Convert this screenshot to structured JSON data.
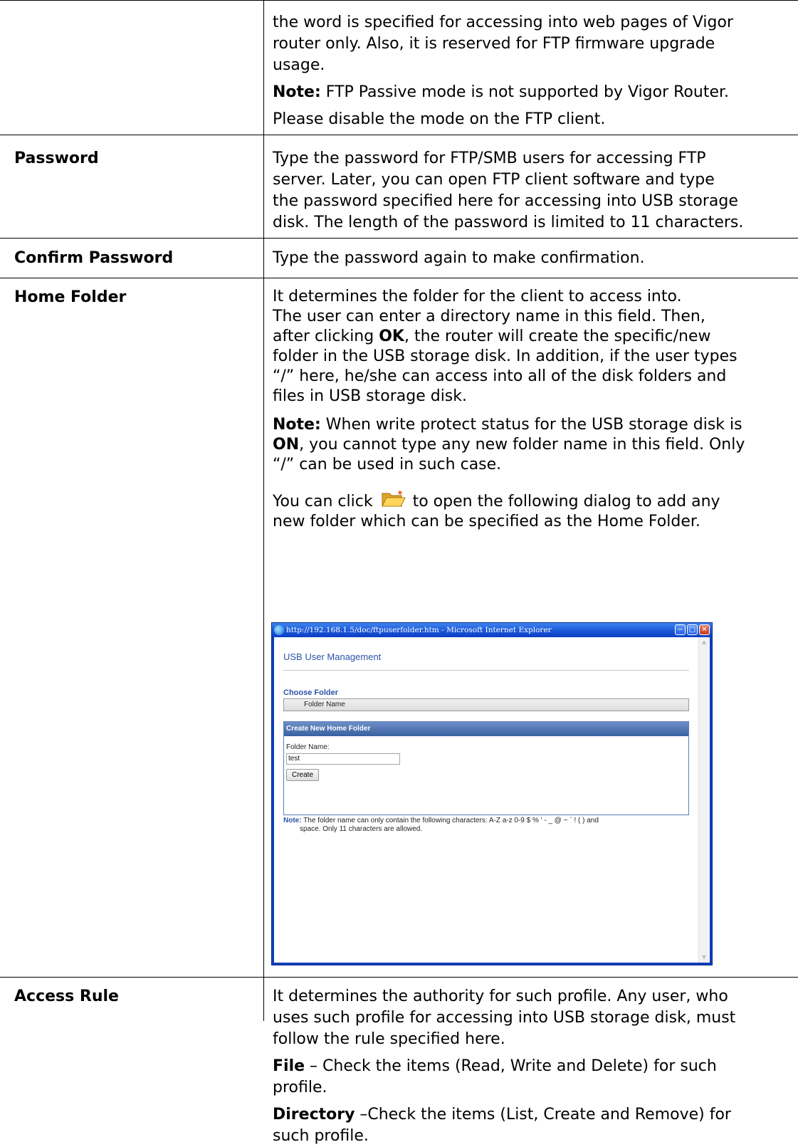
{
  "rows": {
    "first": {
      "lines": [
        "the word is specified for accessing into web pages of Vigor",
        "router only. Also, it is reserved for FTP firmware upgrade",
        "usage."
      ],
      "note_label": "Note:",
      "note_text": " FTP Passive mode is not supported by Vigor Router.",
      "note_line2": "Please disable the mode on the FTP client."
    },
    "password": {
      "label": "Password",
      "lines": [
        "Type the password for FTP/SMB users for accessing FTP",
        "server. Later, you can open FTP client software and type",
        "the password specified here for accessing into USB storage",
        "disk. The length of the password is limited to 11 characters."
      ]
    },
    "confirm": {
      "label": "Confirm Password",
      "text": "Type the password again to make confirmation."
    },
    "home": {
      "label": "Home Folder",
      "line1": "It determines the folder for the client to access into.",
      "line2": "The user can enter a directory name in this field. Then,",
      "line3_pre": "after clicking ",
      "line3_bold": "OK",
      "line3_post": ", the router will create the specific/new",
      "line4": "folder in the USB storage disk. In addition, if the user types",
      "line5": "“/” here, he/she can access into all of the disk folders and",
      "line6": "files in USB storage disk.",
      "note_label": "Note:",
      "note1": " When write protect status for the USB storage disk is",
      "note2_bold": "ON",
      "note2": ", you cannot type any new folder name in this field. Only",
      "note3": "“/” can be used in such case.",
      "click_pre": "You can click",
      "click_post": "to open the following dialog to add any",
      "click_line2": "new folder which can be specified as the Home Folder."
    },
    "access": {
      "label": "Access Rule",
      "lines": [
        "It determines the authority for such profile. Any user, who",
        "uses such profile for accessing into USB storage disk, must",
        "follow the rule specified here."
      ],
      "file_label": "File",
      "file_text": " – Check the items (Read, Write and Delete) for such",
      "file_line2": "profile.",
      "dir_label": "Directory",
      "dir_text": " –Check the items (List, Create and Remove) for",
      "dir_line2": "such profile."
    }
  },
  "dialog": {
    "window_title": "http://192.168.1.5/doc/ftpuserfolder.htm - Microsoft Internet Explorer",
    "page_title": "USB User Management",
    "choose_folder": "Choose Folder",
    "folder_name_header": "Folder Name",
    "create_header": "Create New Home Folder",
    "folder_name_label": "Folder Name:",
    "folder_name_value": "test",
    "create_button": "Create",
    "note_label": "Note:",
    "note_text": " The folder name can only contain the following characters: A-Z a-z 0-9 $ % ' - _ @ ~ ` ! ( ) and",
    "note_line2": "space. Only 11 characters are allowed."
  }
}
